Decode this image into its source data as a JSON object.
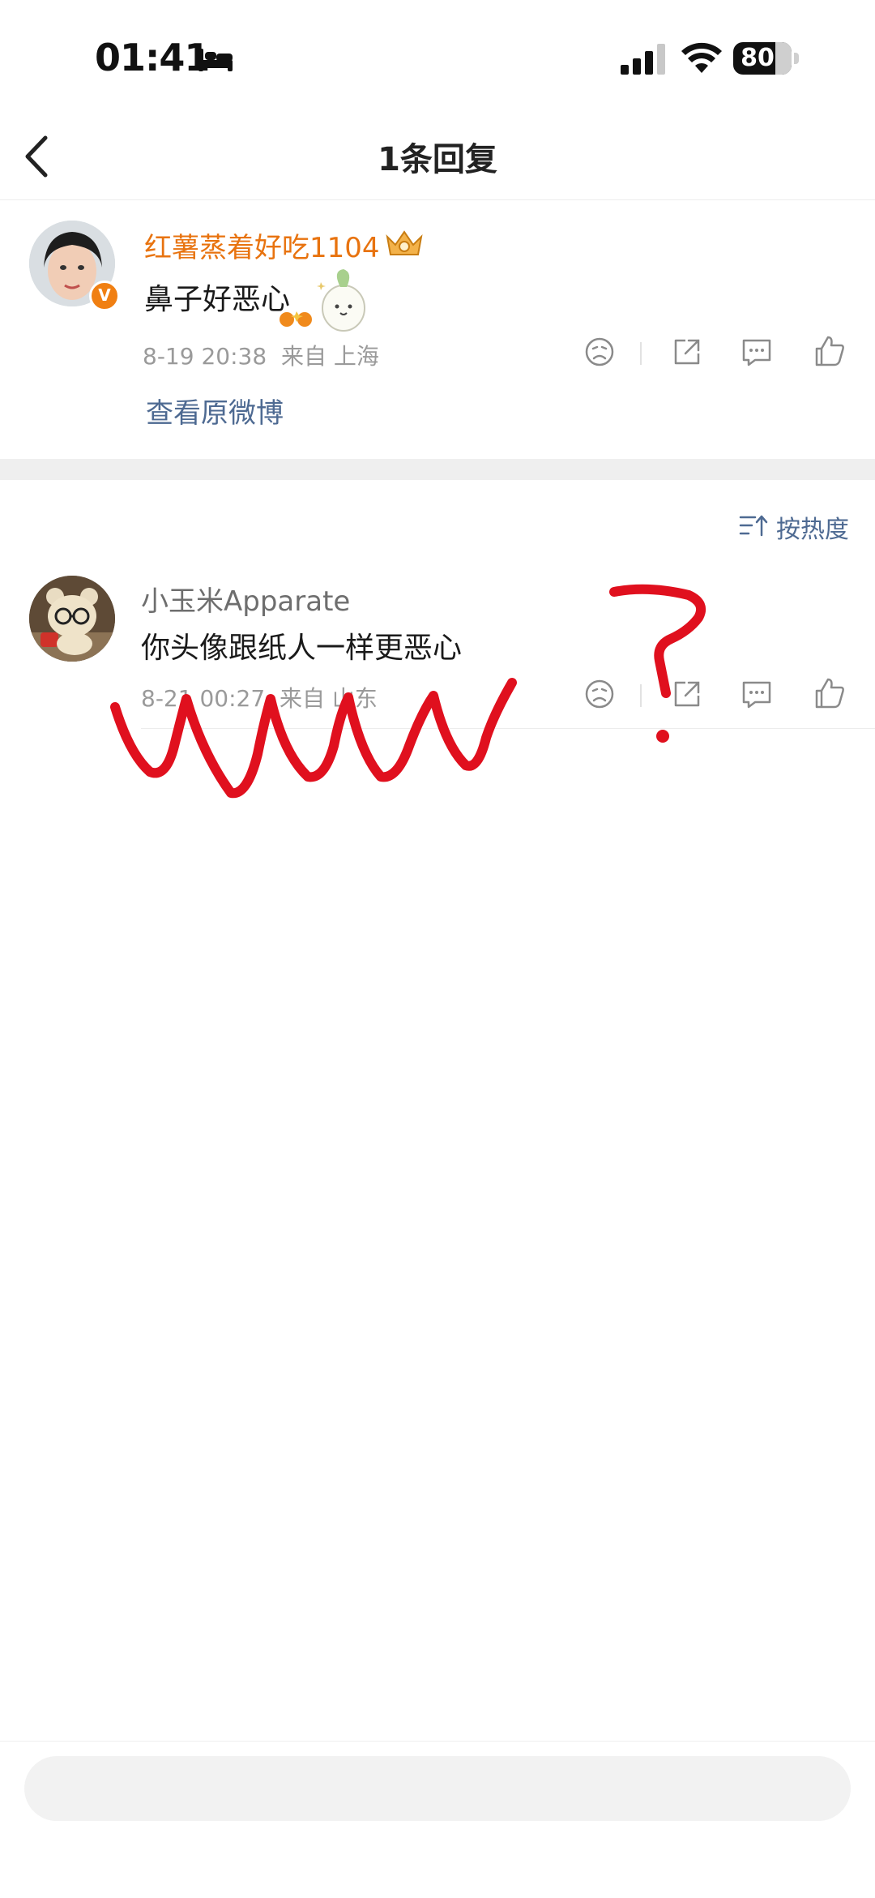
{
  "status_bar": {
    "time": "01:41",
    "battery": "80"
  },
  "nav": {
    "title": "1条回复"
  },
  "original_comment": {
    "username": "红薯蒸着好吃1104",
    "badge": "V",
    "text": "鼻子好恶心",
    "date": "8-19 20:38",
    "location": "来自 上海",
    "view_original_label": "查看原微博"
  },
  "replies": {
    "sort_label": "按热度",
    "items": [
      {
        "username": "小玉米Apparate",
        "text": "你头像跟纸人一样更恶心",
        "date": "8-21 00:27",
        "location": "来自 山东"
      }
    ]
  },
  "input": {
    "placeholder": ""
  },
  "colors": {
    "username_orange": "#e8730f",
    "link_blue": "#4e6a92",
    "annotation_red": "#e0101e"
  }
}
